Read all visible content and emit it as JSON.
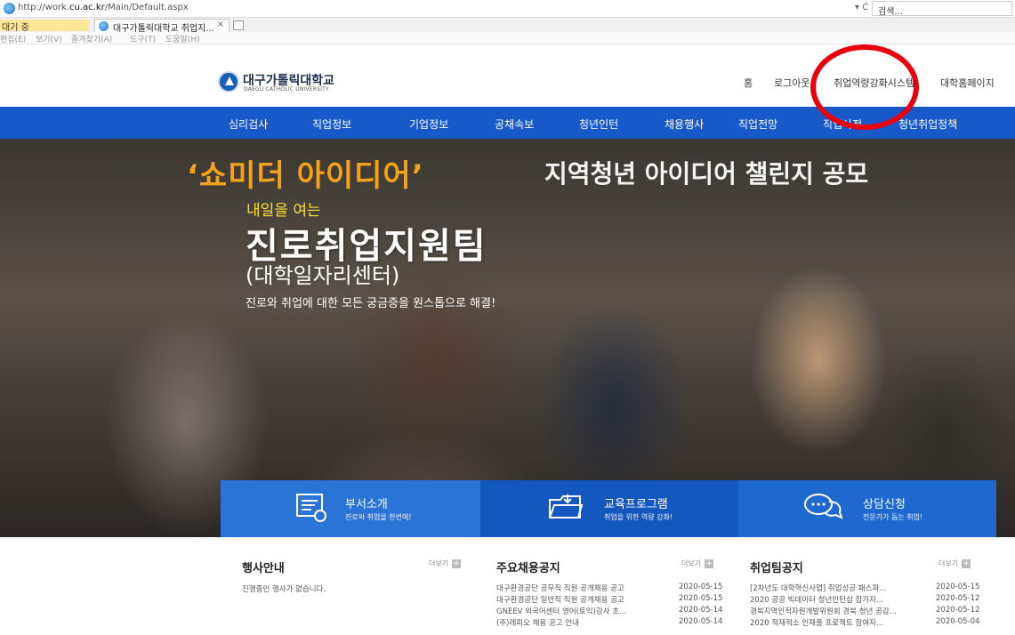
{
  "browser": {
    "url_prefix": "http://work.",
    "url_domain": "cu.ac.kr",
    "url_suffix": "/Main/Default.aspx",
    "refresh": "▾ Ċ",
    "search_placeholder": "검색...",
    "tab_left": "대기 중",
    "tab_title": "대구가톨릭대학교 취업지...",
    "tab_close": "×",
    "menu": [
      "편집(E)",
      "보기(V)",
      "즐겨찾기(A)",
      "도구(T)",
      "도움말(H)"
    ]
  },
  "header": {
    "logo_kr": "대구가톨릭대학교",
    "logo_en": "DAEGU CATHOLIC UNIVERSITY",
    "util_links": [
      "홈",
      "로그아웃",
      "취업역량강화시스템",
      "대학홈페이지"
    ]
  },
  "nav": {
    "items": [
      "심리검사",
      "직업정보",
      "기업정보",
      "공채속보",
      "청년인턴",
      "채용행사",
      "직업전망",
      "직업사전",
      "청년취업정책"
    ]
  },
  "hero": {
    "banner_quote": "‘쇼미더 아이디어’",
    "banner_sub": "지역청년 아이디어 챌린지 공모",
    "kicker": "내일을 여는",
    "title": "진로취업지원팀",
    "subtitle": "(대학일자리센터)",
    "desc": "진로와 취업에 대한 모든 궁금증을 원스톱으로 해결!"
  },
  "quick": [
    {
      "title": "부서소개",
      "sub": "진로와 취업을 한번에!",
      "icon": "document-icon",
      "color": "#2b73d6"
    },
    {
      "title": "교육프로그램",
      "sub": "취업을 위한 역량 강화!",
      "icon": "folder-icon",
      "color": "#1457bf"
    },
    {
      "title": "상담신청",
      "sub": "전문가가 돕는 취업!",
      "icon": "chat-icon",
      "color": "#1f68cf"
    }
  ],
  "boards": {
    "events": {
      "title": "행사안내",
      "more": "더보기",
      "empty": "진행중인 행사가 없습니다."
    },
    "jobs": {
      "title": "주요채용공지",
      "more": "더보기",
      "rows": [
        {
          "text": "대구환경공단 공무직 직원 공개채용 공고",
          "date": "2020-05-15"
        },
        {
          "text": "대구환경공단 일반직 직원 공개채용 공고",
          "date": "2020-05-15"
        },
        {
          "text": "GNEEV 외국어센터 영어(토익)강사 초...",
          "date": "2020-05-14"
        },
        {
          "text": "(주)레피오 채용 공고 안내",
          "date": "2020-05-14"
        }
      ]
    },
    "notices": {
      "title": "취업팀공지",
      "more": "더보기",
      "rows": [
        {
          "text": "[2차년도 대학혁신사업] 취업성공 패스파...",
          "date": "2020-05-15"
        },
        {
          "text": "2020 공공 빅데이터 청년인턴십 참가자...",
          "date": "2020-05-12"
        },
        {
          "text": "경북지역인적자원개발위원회 경북 청년 공감...",
          "date": "2020-05-12"
        },
        {
          "text": "2020 적재적소 인재풀 프로젝트 참여자...",
          "date": "2020-05-04"
        }
      ]
    }
  },
  "colors": {
    "nav_bg": "#1859c9",
    "annotation": "#e8000c",
    "kicker": "#ffe02c",
    "banner_orange": "#f5a21b"
  }
}
